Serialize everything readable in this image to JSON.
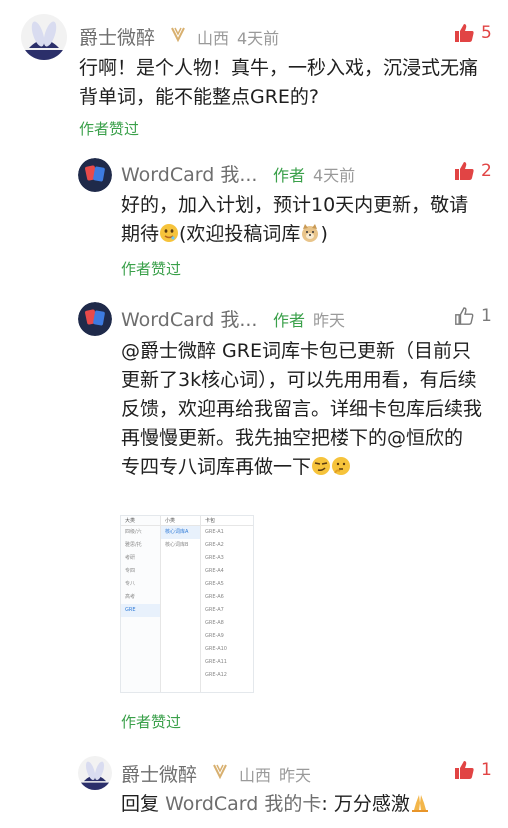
{
  "colors": {
    "like_red": "#e14444",
    "author_green": "#3aa04a",
    "meta_gray": "#9a9a9a"
  },
  "comments": [
    {
      "user": "爵士微醉",
      "region": "山西",
      "time": "4天前",
      "likes": "5",
      "liked": true,
      "text": "行啊！是个人物！真牛，一秒入戏，沉浸式无痛背单词，能不能整点GRE的?",
      "author_liked": "作者赞过"
    }
  ],
  "replies": [
    {
      "user": "WordCard 我...",
      "author_tag": "作者",
      "time": "4天前",
      "likes": "2",
      "liked": true,
      "text_a": "好的，加入计划，预计10天内更新，敬请期待",
      "text_b": "(欢迎投稿词库",
      "text_c": ")",
      "author_liked": "作者赞过"
    },
    {
      "user": "WordCard 我...",
      "author_tag": "作者",
      "time": "昨天",
      "likes": "1",
      "liked": false,
      "text": "@爵士微醉  GRE词库卡包已更新（目前只更新了3k核心词），可以先用用看，有后续反馈，欢迎再给我留言。详细卡包库后续我再慢慢更新。我先抽空把楼下的@恒欣的 专四专八词库再做一下",
      "author_liked": "作者赞过",
      "screenshot": {
        "col1_header": "大类",
        "col1_items": [
          "四级/六",
          "雅思/托",
          "考研",
          "专四",
          "专八",
          "高考",
          "GRE"
        ],
        "col1_selected": 6,
        "col2_header": "小类",
        "col2_items": [
          "核心词库A",
          "核心词库B"
        ],
        "col3_header": "卡包",
        "col3_items": [
          "GRE-A1",
          "GRE-A2",
          "GRE-A3",
          "GRE-A4",
          "GRE-A5",
          "GRE-A6",
          "GRE-A7",
          "GRE-A8",
          "GRE-A9",
          "GRE-A10",
          "GRE-A11",
          "GRE-A12"
        ]
      }
    },
    {
      "user": "爵士微醉",
      "region": "山西",
      "time": "昨天",
      "likes": "1",
      "liked": true,
      "reply_prefix": "回复",
      "reply_to": "WordCard 我的卡",
      "text": ": 万分感激"
    }
  ]
}
